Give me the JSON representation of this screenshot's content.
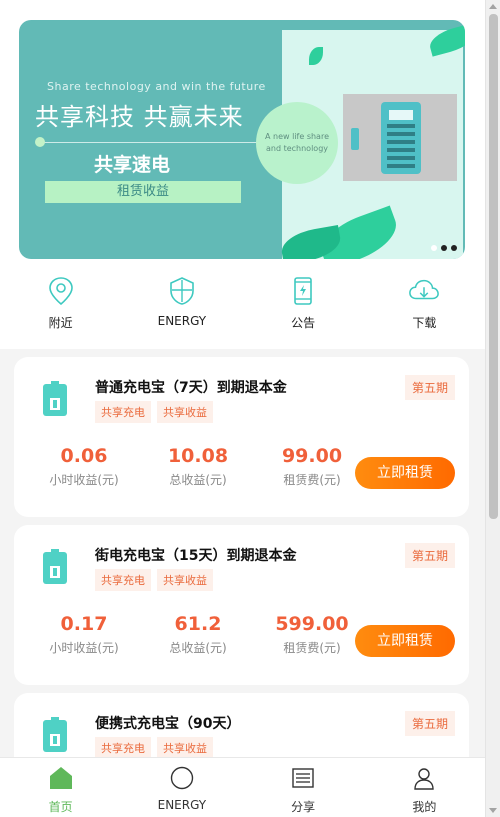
{
  "banner": {
    "english_tagline": "Share technology and win the future",
    "title": "共享科技 共赢未来",
    "subtitle": "共享速电",
    "tag": "租赁收益",
    "circle_text": "A new life share and technology",
    "pages": 3,
    "active_page": 1
  },
  "quicknav": [
    {
      "label": "附近",
      "icon": "location-pin-icon"
    },
    {
      "label": "ENERGY",
      "icon": "shield-icon"
    },
    {
      "label": "公告",
      "icon": "phone-charging-icon"
    },
    {
      "label": "下载",
      "icon": "cloud-download-icon"
    }
  ],
  "products": [
    {
      "name": "普通充电宝（7天）到期退本金",
      "tags": [
        "共享充电",
        "共享收益"
      ],
      "period": "第五期",
      "stats": [
        {
          "value": "0.06",
          "label": "小时收益(元)"
        },
        {
          "value": "10.08",
          "label": "总收益(元)"
        },
        {
          "value": "99.00",
          "label": "租赁费(元)"
        }
      ],
      "button": "立即租赁"
    },
    {
      "name": "街电充电宝（15天）到期退本金",
      "tags": [
        "共享充电",
        "共享收益"
      ],
      "period": "第五期",
      "stats": [
        {
          "value": "0.17",
          "label": "小时收益(元)"
        },
        {
          "value": "61.2",
          "label": "总收益(元)"
        },
        {
          "value": "599.00",
          "label": "租赁费(元)"
        }
      ],
      "button": "立即租赁"
    },
    {
      "name": "便携式充电宝（90天）",
      "tags": [
        "共享充电",
        "共享收益"
      ],
      "period": "第五期",
      "stats": [],
      "button": ""
    }
  ],
  "tabbar": [
    {
      "label": "首页",
      "icon": "home-icon",
      "active": true
    },
    {
      "label": "ENERGY",
      "icon": "circle-icon",
      "active": false
    },
    {
      "label": "分享",
      "icon": "list-icon",
      "active": false
    },
    {
      "label": "我的",
      "icon": "user-icon",
      "active": false
    }
  ],
  "colors": {
    "accent": "#4fd1c5",
    "orange": "#ff7a00",
    "value_red": "#f0603a",
    "tab_active": "#5fb85a"
  }
}
